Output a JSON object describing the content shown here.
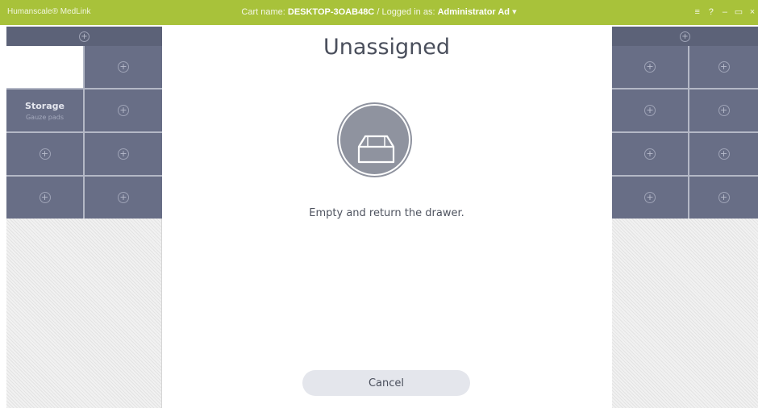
{
  "titlebar": {
    "app_name": "Humanscale® MedLink",
    "cart_label": "Cart name:",
    "cart_name": "DESKTOP-3OAB48C",
    "separator": "/",
    "logged_label": "Logged in as:",
    "user": "Administrator Ad",
    "user_caret": "▾",
    "controls": {
      "menu": "≡",
      "help": "?",
      "minimize": "–",
      "restore": "▭",
      "close": "×"
    },
    "color": "#a8c23a"
  },
  "left_panel": {
    "header_icon": "+",
    "cells": [
      {
        "type": "white",
        "title": "",
        "subtitle": ""
      },
      {
        "type": "add",
        "icon": "+"
      },
      {
        "type": "label",
        "title": "Storage",
        "subtitle": "Gauze pads"
      },
      {
        "type": "add",
        "icon": "+"
      },
      {
        "type": "add",
        "icon": "+"
      },
      {
        "type": "add",
        "icon": "+"
      },
      {
        "type": "add",
        "icon": "+"
      },
      {
        "type": "add",
        "icon": "+"
      }
    ]
  },
  "right_panel": {
    "header_icon": "+",
    "cell_icon": "+"
  },
  "dialog": {
    "title": "Unassigned",
    "icon": "drawer-icon",
    "message": "Empty and return the drawer.",
    "cancel_label": "Cancel"
  },
  "colors": {
    "panel_dark": "#5c6278",
    "cell": "#686e86",
    "button_bg": "#e4e6ec"
  }
}
